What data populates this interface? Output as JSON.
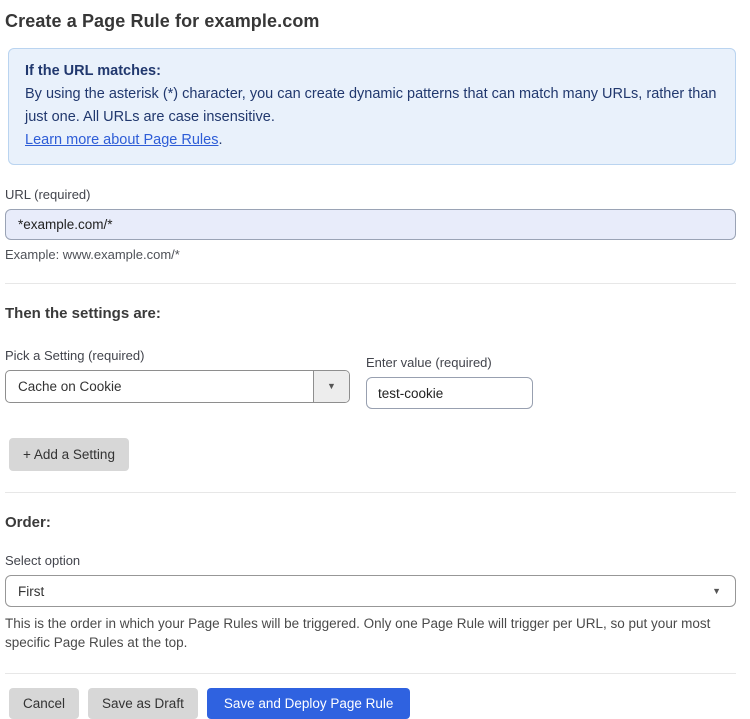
{
  "page": {
    "title": "Create a Page Rule for example.com"
  },
  "info_banner": {
    "heading": "If the URL matches:",
    "body": "By using the asterisk (*) character, you can create dynamic patterns that can match many URLs, rather than just one. All URLs are case insensitive.",
    "link_label": "Learn more about Page Rules",
    "link_suffix": "."
  },
  "url_field": {
    "label": "URL (required)",
    "value": "*example.com/*",
    "helper": "Example: www.example.com/*"
  },
  "settings_section": {
    "heading": "Then the settings are:",
    "setting_select": {
      "label": "Pick a Setting (required)",
      "value": "Cache on Cookie"
    },
    "value_field": {
      "label": "Enter value (required)",
      "value": "test-cookie"
    },
    "add_button_label": "+ Add a Setting"
  },
  "order_section": {
    "heading": "Order:",
    "select_label": "Select option",
    "select_value": "First",
    "helper": "This is the order in which your Page Rules will be triggered. Only one Page Rule will trigger per URL, so put your most specific Page Rules at the top."
  },
  "actions": {
    "cancel_label": "Cancel",
    "save_draft_label": "Save as Draft",
    "deploy_label": "Save and Deploy Page Rule"
  },
  "icons": {
    "dropdown_arrow": "▼"
  },
  "colors": {
    "banner_bg": "#e9f1fb",
    "banner_border": "#bad4f0",
    "banner_text": "#21386e",
    "link_blue": "#2e5dd7",
    "url_input_bg": "#e8ecfa",
    "primary_button_bg": "#2f62e0",
    "gray_button_bg": "#d7d7d7"
  }
}
